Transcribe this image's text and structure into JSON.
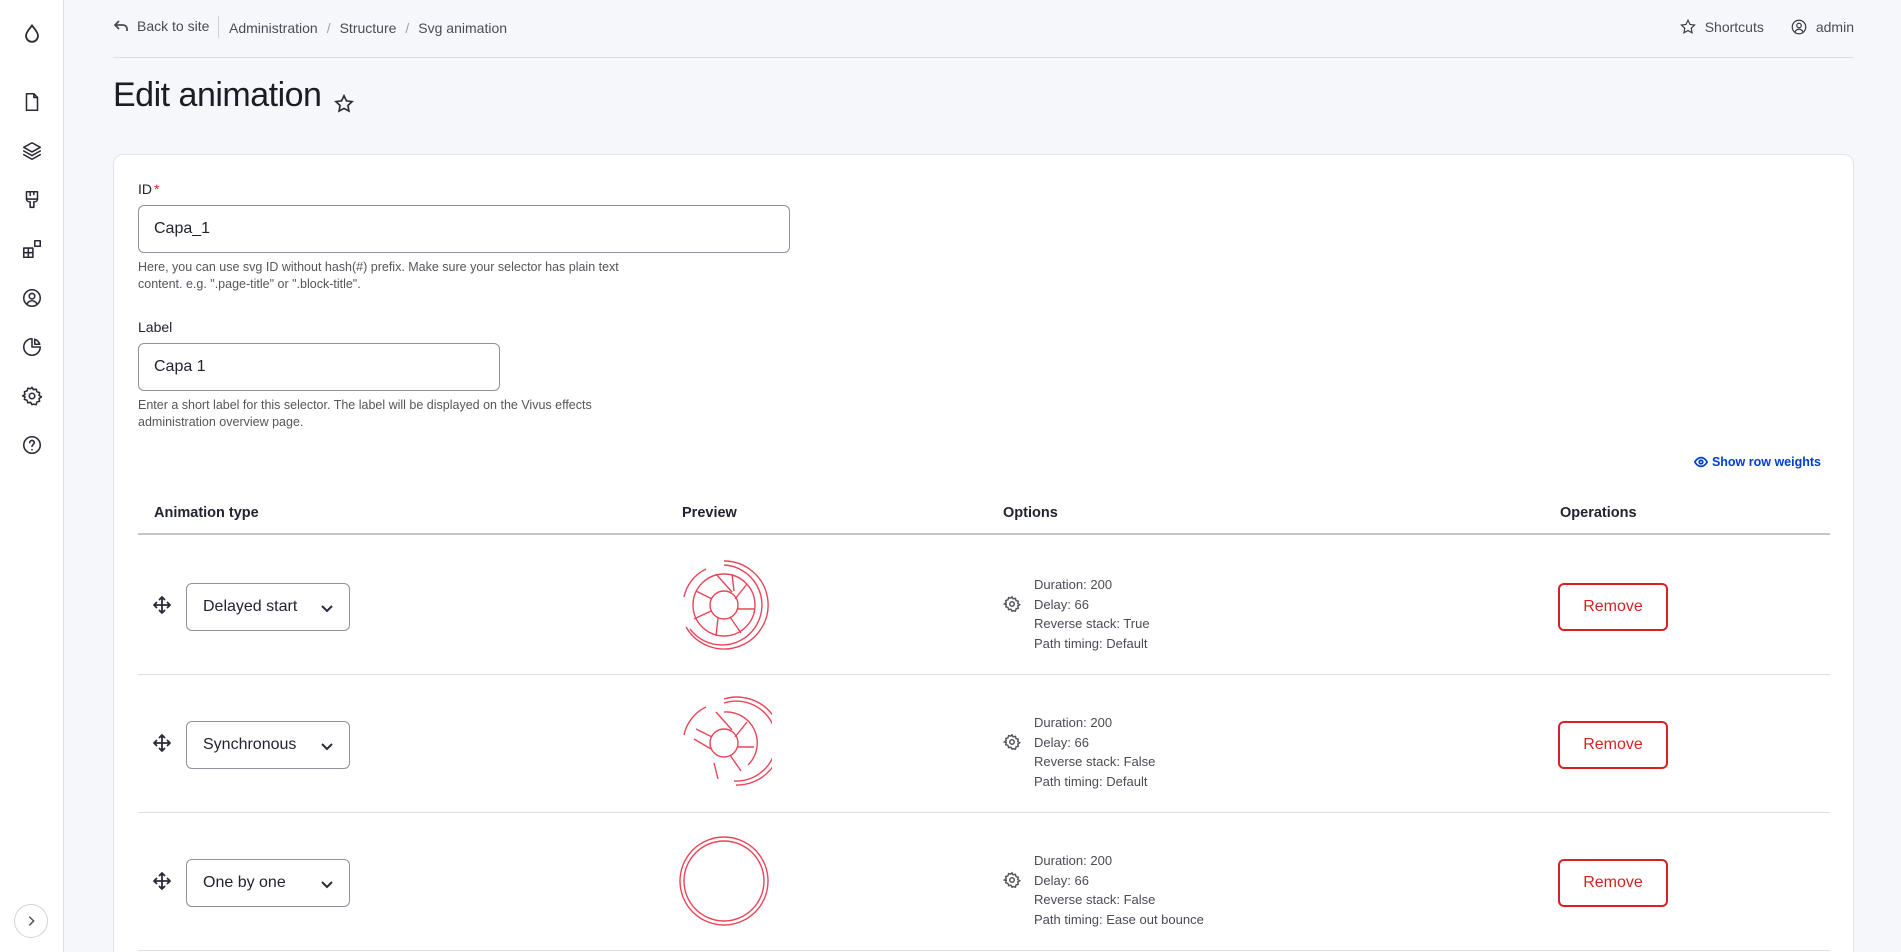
{
  "topbar": {
    "back_label": "Back to site",
    "breadcrumb": [
      "Administration",
      "Structure",
      "Svg animation"
    ],
    "shortcuts_label": "Shortcuts",
    "user_label": "admin"
  },
  "page": {
    "title": "Edit animation"
  },
  "form": {
    "id": {
      "label": "ID",
      "required_mark": "*",
      "value": "Capa_1",
      "help": "Here, you can use svg ID without hash(#) prefix. Make sure your selector has plain text content. e.g. \".page-title\" or \".block-title\"."
    },
    "label": {
      "label": "Label",
      "value": "Capa 1",
      "help": "Enter a short label for this selector. The label will be displayed on the Vivus effects administration overview page."
    }
  },
  "table": {
    "row_weights_label": "Show row weights",
    "headers": {
      "animation_type": "Animation type",
      "preview": "Preview",
      "options": "Options",
      "operations": "Operations"
    },
    "remove_label": "Remove",
    "rows": [
      {
        "type": "Delayed start",
        "duration": "Duration: 200",
        "delay": "Delay: 66",
        "reverse": "Reverse stack: True",
        "timing": "Path timing: Default"
      },
      {
        "type": "Synchronous",
        "duration": "Duration: 200",
        "delay": "Delay: 66",
        "reverse": "Reverse stack: False",
        "timing": "Path timing: Default"
      },
      {
        "type": "One by one",
        "duration": "Duration: 200",
        "delay": "Delay: 66",
        "reverse": "Reverse stack: False",
        "timing": "Path timing: Ease out bounce"
      }
    ]
  },
  "colors": {
    "accent_blue": "#003ecc",
    "danger_red": "#d72222",
    "preview_stroke": "#e8455a"
  },
  "icons": {
    "sidebar": [
      "drupal-drop-icon",
      "content-icon",
      "structure-icon",
      "appearance-icon",
      "extend-icon",
      "people-icon",
      "reports-icon",
      "configuration-icon",
      "help-icon"
    ]
  }
}
